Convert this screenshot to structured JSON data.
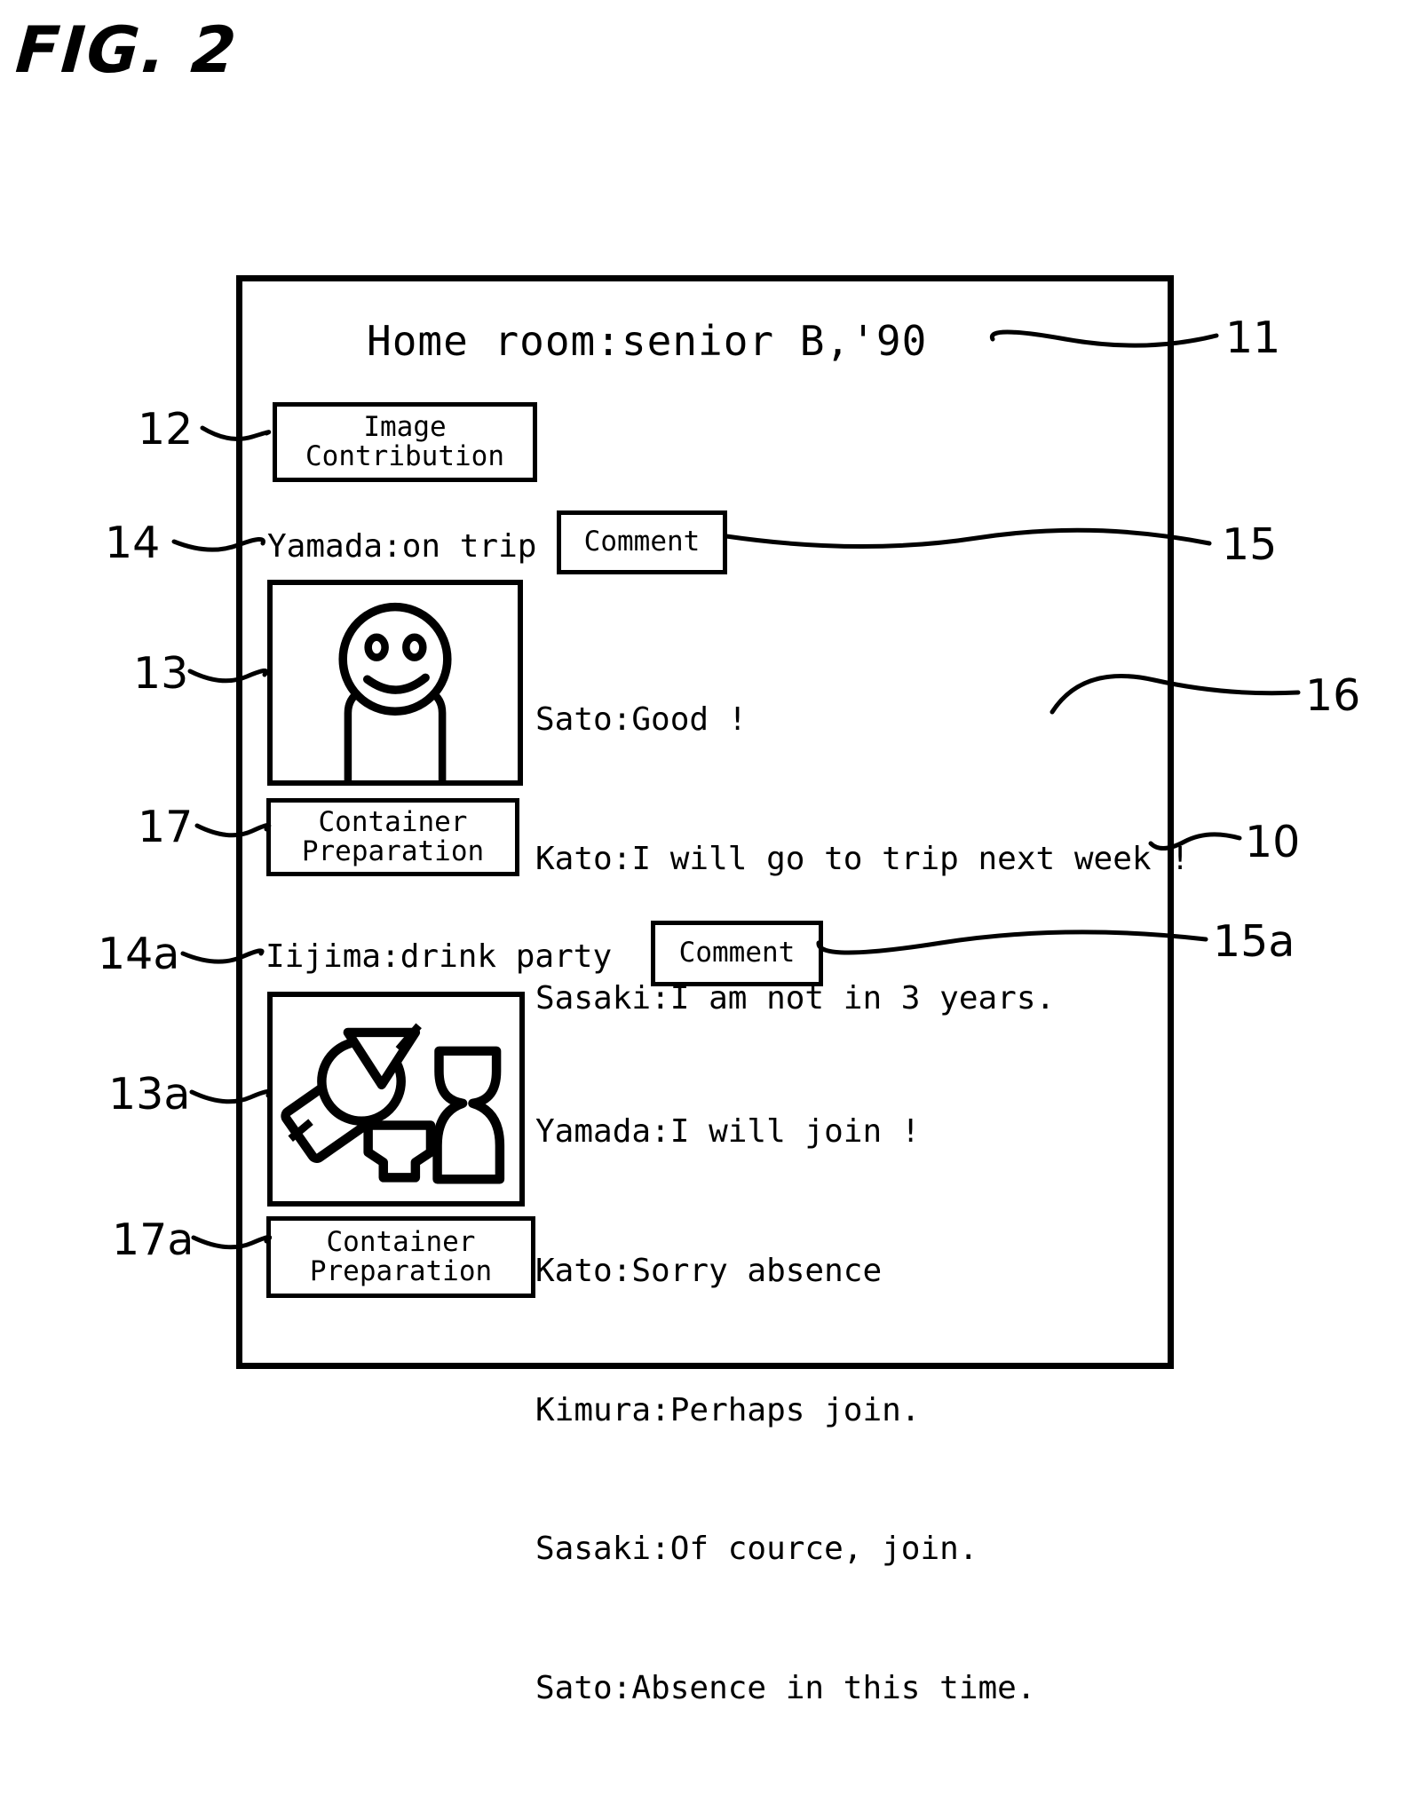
{
  "figure": {
    "label": "FIG. 2"
  },
  "screen": {
    "title": "Home room:senior B,'90",
    "buttons": {
      "image_contribution": "Image\nContribution",
      "comment_1": "Comment",
      "comment_2": "Comment",
      "container_preparation_1": "Container\nPreparation",
      "container_preparation_2": "Container\nPreparation"
    },
    "posts": [
      {
        "heading": "Yamada:on trip",
        "image_alt": "smiling-person-photo",
        "comments": [
          "Sato:Good !",
          "Kato:I will go to trip next week !",
          "Sasaki:I am not in 3 years."
        ]
      },
      {
        "heading": "Iijima:drink party",
        "image_alt": "drink-party-dishes-photo",
        "comments": [
          "Yamada:I will join !",
          "Kato:Sorry absence",
          "Kimura:Perhaps join.",
          "Sasaki:Of cource, join.",
          "Sato:Absence in this time."
        ]
      }
    ]
  },
  "reference_numbers": {
    "screen": "10",
    "title": "11",
    "image_contribution_button": "12",
    "image_1": "13",
    "image_2": "13a",
    "heading_1": "14",
    "heading_2": "14a",
    "comment_button_1": "15",
    "comment_button_2": "15a",
    "comment_text": "16",
    "container_prep_1": "17",
    "container_prep_2": "17a"
  },
  "colors": {
    "ink": "#000000",
    "paper": "#ffffff"
  }
}
